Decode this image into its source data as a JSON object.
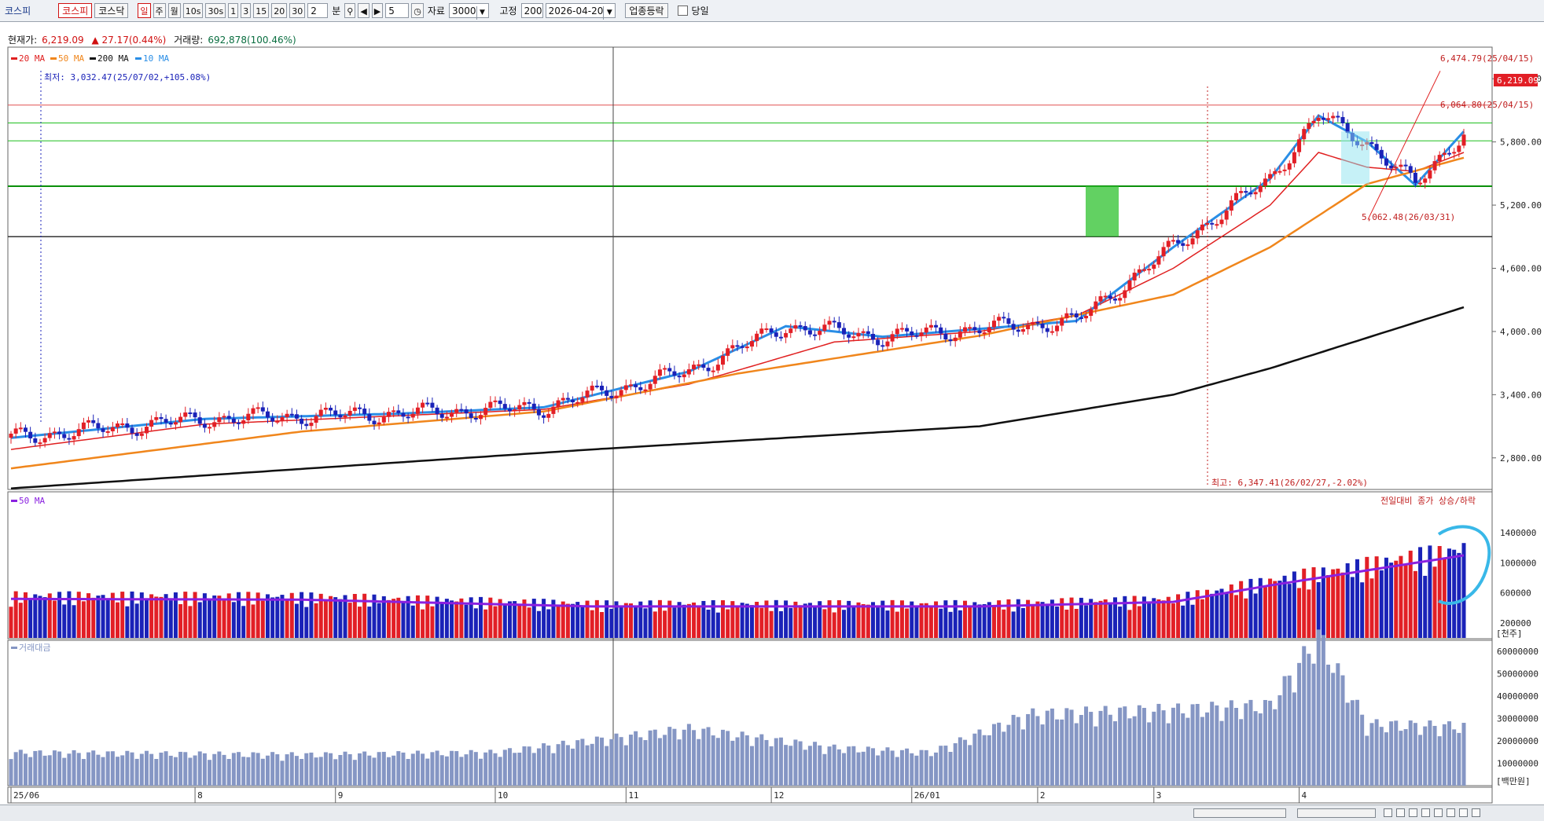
{
  "toolbar": {
    "title": "코스피",
    "market_tabs": [
      "코스피",
      "코스닥"
    ],
    "period_tabs": [
      "일",
      "주",
      "월",
      "10s",
      "30s",
      "1",
      "3",
      "15",
      "20",
      "30"
    ],
    "minute_value": "2",
    "minute_label": "분",
    "step_value": "5",
    "data_label": "자료",
    "data_count": "3000",
    "fixed_label": "고정",
    "fixed_value": "200",
    "date_value": "2026-04-20",
    "sector_button": "업종등락",
    "sameday_label": "당일"
  },
  "info": {
    "price_label": "현재가:",
    "price": "6,219.09",
    "change": "▲ 27.17(0.44%)",
    "volume_label": "거래량:",
    "volume": "692,878(100.46%)"
  },
  "legend": {
    "ma20": "20 MA",
    "ma50": "50 MA",
    "ma200": "200 MA",
    "ma10": "10 MA",
    "volume_ma": "50 MA",
    "amount": "거래대금",
    "volume_note": "전일대비 종가 상승/하락"
  },
  "annotations": {
    "low": "최저: 3,032.47(25/07/02,+105.08%)",
    "high": "최고: 6,347.41(26/02/27,-2.02%)",
    "level_6474": "6,474.79(25/04/15)",
    "level_6064": "6,064.80(25/04/15)",
    "level_5062": "5,062.48(26/03/31)",
    "current_tag": "6,219.09"
  },
  "units": {
    "volume": "[천주]",
    "amount": "[백만원]"
  },
  "colors": {
    "up": "#e21f26",
    "down": "#1a22b8",
    "ma20": "#e02020",
    "ma50": "#f0861c",
    "ma200": "#111111",
    "ma10": "#2a8ee6",
    "volume_ma": "#8a20e0",
    "amount_bar": "#8596c4"
  },
  "chart_data": [
    {
      "type": "candlestick",
      "title": "코스피",
      "x_tick_labels": [
        "25/06",
        "8",
        "9",
        "10",
        "11",
        "12",
        "26/01",
        "2",
        "3",
        "4"
      ],
      "y_tick_labels": [
        "6,400.00",
        "5,800.00",
        "5,200.00",
        "4,600.00",
        "4,000.00",
        "3,400.00",
        "2,800.00"
      ],
      "ylim": [
        2500,
        6700
      ],
      "series": [
        {
          "name": "20 MA",
          "close_anchors": [
            [
              0,
              2880
            ],
            [
              40,
              3120
            ],
            [
              80,
              3200
            ],
            [
              110,
              3260
            ],
            [
              140,
              3500
            ],
            [
              150,
              3630
            ],
            [
              170,
              3900
            ],
            [
              200,
              4000
            ],
            [
              220,
              4150
            ],
            [
              240,
              4600
            ],
            [
              260,
              5200
            ],
            [
              270,
              5700
            ],
            [
              280,
              5560
            ],
            [
              290,
              5520
            ],
            [
              300,
              5700
            ]
          ]
        },
        {
          "name": "10 MA",
          "close_anchors": [
            [
              0,
              2990
            ],
            [
              40,
              3170
            ],
            [
              80,
              3220
            ],
            [
              110,
              3280
            ],
            [
              140,
              3620
            ],
            [
              160,
              4050
            ],
            [
              180,
              3950
            ],
            [
              220,
              4100
            ],
            [
              240,
              4800
            ],
            [
              260,
              5450
            ],
            [
              270,
              6050
            ],
            [
              280,
              5800
            ],
            [
              290,
              5390
            ],
            [
              300,
              5900
            ]
          ]
        },
        {
          "name": "50 MA",
          "close_anchors": [
            [
              0,
              2700
            ],
            [
              60,
              3050
            ],
            [
              110,
              3240
            ],
            [
              150,
              3600
            ],
            [
              200,
              3960
            ],
            [
              240,
              4350
            ],
            [
              260,
              4800
            ],
            [
              280,
              5400
            ],
            [
              300,
              5650
            ]
          ]
        },
        {
          "name": "200 MA",
          "close_anchors": [
            [
              0,
              2510
            ],
            [
              120,
              2880
            ],
            [
              200,
              3100
            ],
            [
              240,
              3400
            ],
            [
              260,
              3650
            ],
            [
              300,
              4230
            ]
          ]
        }
      ],
      "annotation_values": {
        "low": 3032.47,
        "high": 6347.41,
        "current": 6219.09
      }
    },
    {
      "type": "bar",
      "title": "",
      "y_tick_labels": [
        "1400000",
        "1000000",
        "600000",
        "200000"
      ],
      "ylim": [
        0,
        1800000
      ],
      "series": [
        {
          "name": "50 MA",
          "level_anchors": [
            [
              0,
              520000
            ],
            [
              60,
              510000
            ],
            [
              120,
              420000
            ],
            [
              200,
              420000
            ],
            [
              240,
              480000
            ],
            [
              260,
              700000
            ],
            [
              280,
              900000
            ],
            [
              300,
              1100000
            ]
          ]
        }
      ]
    },
    {
      "type": "bar",
      "title": "",
      "y_tick_labels": [
        "60000000",
        "50000000",
        "40000000",
        "30000000",
        "20000000",
        "10000000"
      ],
      "ylim": [
        0,
        65000000
      ],
      "series": [
        {
          "name": "거래대금",
          "level_anchors": [
            [
              0,
              14000000
            ],
            [
              60,
              13000000
            ],
            [
              100,
              14000000
            ],
            [
              120,
              19000000
            ],
            [
              140,
              24000000
            ],
            [
              170,
              16000000
            ],
            [
              190,
              14000000
            ],
            [
              200,
              22000000
            ],
            [
              210,
              30000000
            ],
            [
              240,
              32000000
            ],
            [
              260,
              34000000
            ],
            [
              270,
              63000000
            ],
            [
              280,
              26000000
            ],
            [
              300,
              25000000
            ]
          ]
        }
      ]
    }
  ]
}
